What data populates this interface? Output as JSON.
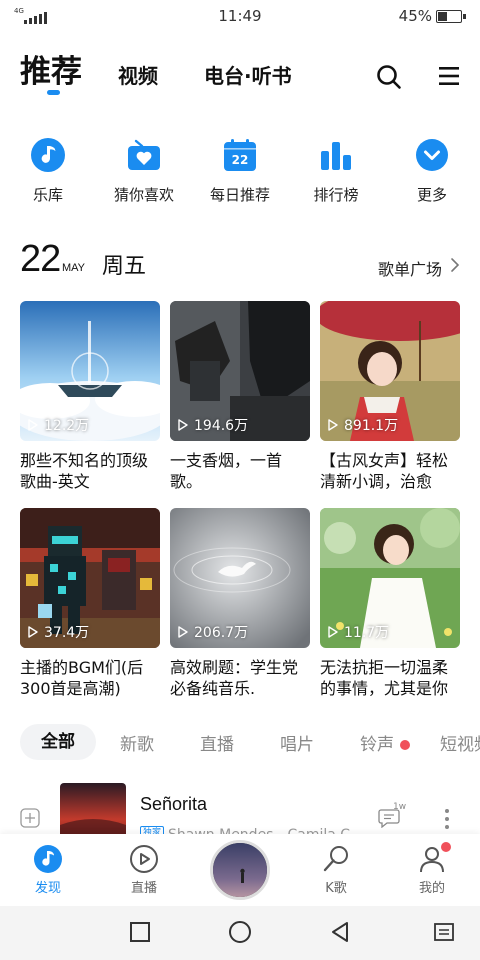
{
  "status": {
    "network": "4G",
    "time": "11:49",
    "battery": "45%",
    "battery_level": 0.45
  },
  "topnav": {
    "recommend": "推荐",
    "video": "视频",
    "radio": "电台·听书"
  },
  "quick": [
    {
      "label": "乐库",
      "icon": "music-note-icon"
    },
    {
      "label": "猜你喜欢",
      "icon": "radio-heart-icon"
    },
    {
      "label": "每日推荐",
      "icon": "calendar-icon",
      "badge": "22"
    },
    {
      "label": "排行榜",
      "icon": "bar-chart-icon"
    },
    {
      "label": "更多",
      "icon": "chevron-down-icon"
    }
  ],
  "date": {
    "day": "22",
    "month": "MAY",
    "weekday": "周五",
    "plaza": "歌单广场"
  },
  "playlists": [
    {
      "plays": "12.2万",
      "title": "那些不知名的顶级歌曲-英文"
    },
    {
      "plays": "194.6万",
      "title": "一支香烟，一首歌。"
    },
    {
      "plays": "891.1万",
      "title": "【古风女声】轻松清新小调，治愈你..."
    },
    {
      "plays": "37.4万",
      "title": "主播的BGM们(后300首是高潮)"
    },
    {
      "plays": "206.7万",
      "title": "高效刷题：学生党必备纯音乐."
    },
    {
      "plays": "11.7万",
      "title": "无法抗拒一切温柔的事情，尤其是你"
    }
  ],
  "filters": [
    "全部",
    "新歌",
    "直播",
    "唱片",
    "铃声",
    "短视频"
  ],
  "song": {
    "title": "Señorita",
    "vip": "独家",
    "artist": "Shawn Mendes、Camila C",
    "comments": "1w"
  },
  "tabbar": [
    {
      "label": "发现",
      "icon": "discover-icon"
    },
    {
      "label": "直播",
      "icon": "live-icon"
    },
    {
      "label": "",
      "icon": "now-playing-disc"
    },
    {
      "label": "K歌",
      "icon": "karaoke-mic-icon"
    },
    {
      "label": "我的",
      "icon": "profile-icon"
    }
  ],
  "colors": {
    "accent": "#1a8cf0",
    "red_dot": "#f0505a"
  }
}
